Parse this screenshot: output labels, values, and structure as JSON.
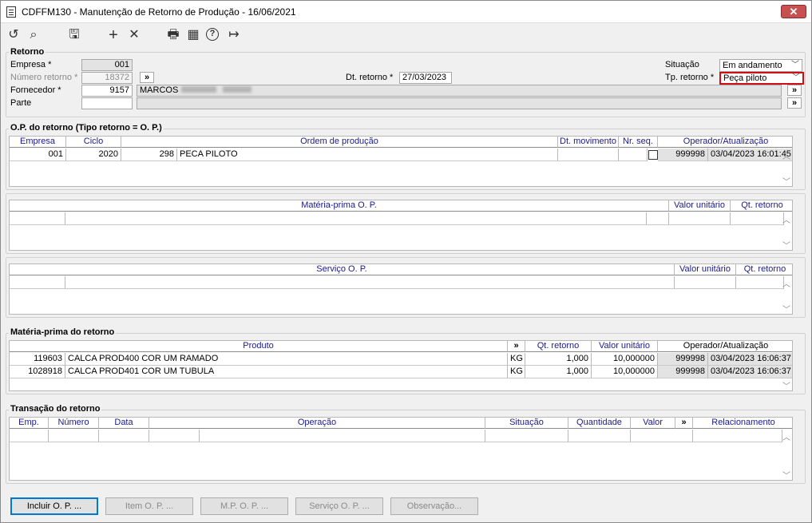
{
  "window": {
    "title": "CDFFM130 - Manutenção de Retorno de Produção - 16/06/2021",
    "close": "✕"
  },
  "toolbar": {
    "undo": "↺",
    "search": "⌕",
    "save": "🖫",
    "add": "+",
    "remove": "✕",
    "print": "🖶",
    "calendar": "▦",
    "help": "?",
    "exit": "↦"
  },
  "retorno": {
    "title": "Retorno",
    "empresa_label": "Empresa *",
    "empresa": "001",
    "numero_label": "Número retorno *",
    "numero": "18372",
    "fornecedor_label": "Fornecedor *",
    "fornecedor": "9157",
    "fornecedor_nome": "MARCOS",
    "parte_label": "Parte",
    "parte": "",
    "dt_label": "Dt. retorno *",
    "dt": "27/03/2023",
    "situacao_label": "Situação",
    "situacao": "Em andamento",
    "tp_label": "Tp. retorno *",
    "tp": "Peça piloto",
    "more": "»"
  },
  "op": {
    "title": "O.P. do retorno (Tipo retorno = O. P.)",
    "headers": [
      "Empresa",
      "Ciclo",
      "Ordem de produção",
      "Dt. movimento",
      "Nr. seq.",
      "Operador/Atualização"
    ],
    "row": {
      "empresa": "001",
      "ciclo": "2020",
      "op": "298",
      "desc": "PECA PILOTO",
      "dt": "",
      "seq": "",
      "operador": "999998",
      "atualizacao": "03/04/2023 16:01:45"
    }
  },
  "mp_op": {
    "headers": [
      "Matéria-prima O. P.",
      "Valor unitário",
      "Qt. retorno"
    ]
  },
  "serv_op": {
    "headers": [
      "Serviço O. P.",
      "Valor unitário",
      "Qt. retorno"
    ]
  },
  "mp_ret": {
    "title": "Matéria-prima do retorno",
    "headers": [
      "Produto",
      "»",
      "Qt. retorno",
      "Valor unitário",
      "Operador/Atualização"
    ],
    "rows": [
      {
        "cod": "119603",
        "desc": "CALCA PROD400 COR UM RAMADO",
        "un": "KG",
        "qt": "1,000",
        "valor": "10,000000",
        "operador": "999998",
        "atualizacao": "03/04/2023 16:06:37"
      },
      {
        "cod": "1028918",
        "desc": "CALCA PROD401 COR UM TUBULA",
        "un": "KG",
        "qt": "1,000",
        "valor": "10,000000",
        "operador": "999998",
        "atualizacao": "03/04/2023 16:06:37"
      }
    ]
  },
  "trans": {
    "title": "Transação do retorno",
    "headers": [
      "Emp.",
      "Número",
      "Data",
      "Operação",
      "Situação",
      "Quantidade",
      "Valor",
      "»",
      "Relacionamento"
    ]
  },
  "buttons": [
    "Incluir O. P. ...",
    "Item O. P. ...",
    "M.P. O. P. ...",
    "Serviço O. P. ...",
    "Observação..."
  ]
}
